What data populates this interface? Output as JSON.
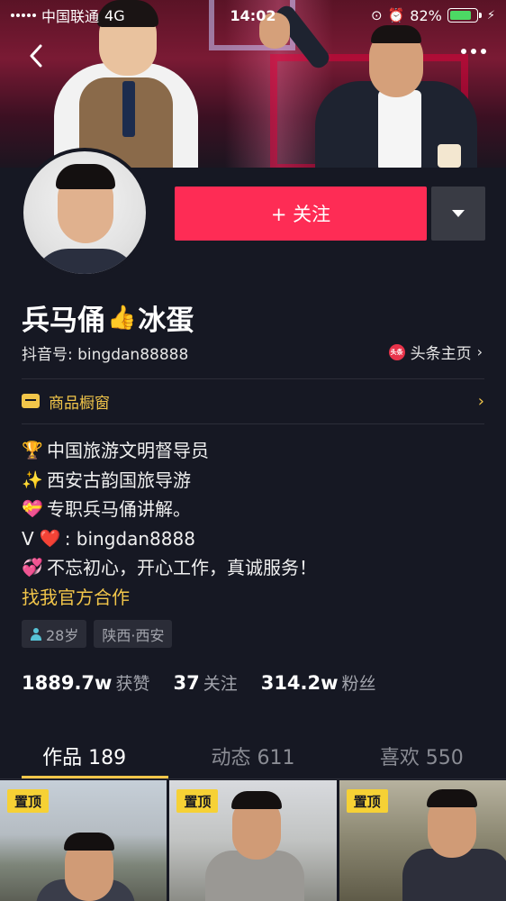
{
  "status_bar": {
    "carrier": "中国联通",
    "network": "4G",
    "time": "14:02",
    "battery": "82%",
    "battery_level": 0.82
  },
  "profile": {
    "name": "兵马俑",
    "name_suffix": "冰蛋",
    "name_emoji": "👍",
    "douyin_id": "抖音号: bingdan88888",
    "toutiao_logo": "头条",
    "toutiao_link": "头条主页",
    "follow_label": "+ 关注",
    "shop_label": "商品橱窗"
  },
  "bio": [
    {
      "emoji": "🏆",
      "text": "中国旅游文明督导员"
    },
    {
      "emoji": "✨",
      "text": "西安古韵国旅导游"
    },
    {
      "emoji": "💝",
      "text": "专职兵马俑讲解。"
    },
    {
      "emoji": "❤️",
      "prefix": "V",
      "text": ": bingdan8888"
    },
    {
      "emoji": "💞",
      "text": "不忘初心，开心工作，真诚服务！"
    }
  ],
  "official_link": "找我官方合作",
  "tags": {
    "age": "28岁",
    "location": "陕西·西安"
  },
  "stats": [
    {
      "num": "1889.7w",
      "label": "获赞"
    },
    {
      "num": "37",
      "label": "关注"
    },
    {
      "num": "314.2w",
      "label": "粉丝"
    }
  ],
  "tabs": [
    {
      "label": "作品 189",
      "active": true
    },
    {
      "label": "动态 611",
      "active": false
    },
    {
      "label": "喜欢 550",
      "active": false
    }
  ],
  "videos": [
    {
      "pin": "置顶"
    },
    {
      "pin": "置顶"
    },
    {
      "pin": "置顶"
    }
  ],
  "colors": {
    "background": "#161823",
    "follow": "#fe2c55",
    "accent": "#f2c64a"
  }
}
